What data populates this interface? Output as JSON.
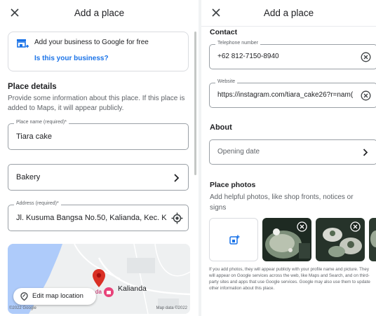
{
  "left": {
    "title": "Add a place",
    "promo": {
      "text": "Add your business to Google for free",
      "link": "Is this your business?"
    },
    "place_details": {
      "title": "Place details",
      "desc": "Provide some information about this place. If this place is added to Maps, it will appear publicly."
    },
    "name_field": {
      "label": "Place name (required)*",
      "value": "Tiara cake"
    },
    "category_field": {
      "value": "Bakery"
    },
    "address_field": {
      "label": "Address (required)*",
      "value": "Jl. Kusuma Bangsa No.50, Kalianda, Kec. K"
    },
    "map": {
      "button": "Edit map location",
      "place_label": "Kalianda",
      "partial_label": "da",
      "copyright_left": "©2022 Google",
      "copyright_right": "Map data ©2022"
    }
  },
  "right": {
    "title": "Add a place",
    "contact": {
      "title": "Contact",
      "phone_label": "Telephone number",
      "phone_value": "+62 812-7150-8940",
      "website_label": "Website",
      "website_value": "https://instagram.com/tiara_cake26?r=nam("
    },
    "about": {
      "title": "About",
      "opening_date": "Opening date"
    },
    "photos": {
      "title": "Place photos",
      "desc": "Add helpful photos, like shop fronts, notices or signs",
      "fine_print": "If you add photos, they will appear publicly with your profile name and picture. They will appear on Google services across the web, like Maps and Search, and on third-party sites and apps that use Google services. Google may also use them to update other information about this place."
    }
  },
  "colors": {
    "link_blue": "#1a73e8",
    "pin_red": "#d93025",
    "marker_pink": "#e8437a"
  }
}
